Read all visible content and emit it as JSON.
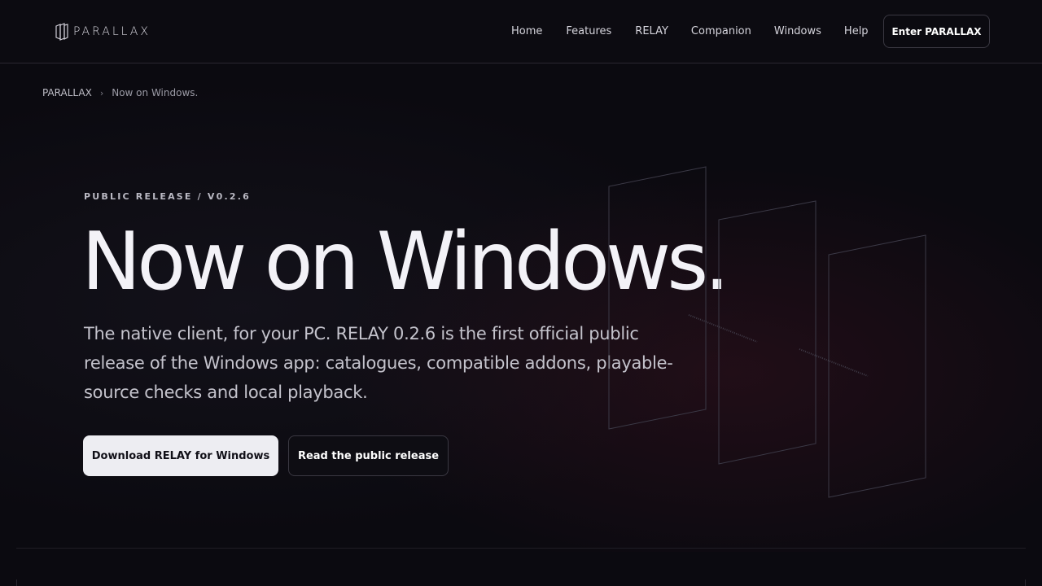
{
  "brand": {
    "name": "PARALLAX"
  },
  "nav": {
    "items": [
      "Home",
      "Features",
      "RELAY",
      "Companion",
      "Windows",
      "Help"
    ],
    "cta": "Enter PARALLAX"
  },
  "breadcrumb": {
    "root": "PARALLAX",
    "separator": "›",
    "current": "Now on Windows."
  },
  "hero": {
    "eyebrow": "PUBLIC RELEASE / V0.2.6",
    "title": "Now on Windows.",
    "description": "The native client, for your PC. RELAY 0.2.6 is the first official public release of the Windows app: catalogues, compatible addons, playable-source checks and local playback.",
    "primary_button": "Download RELAY for Windows",
    "secondary_button": "Read the public release"
  },
  "icons": {
    "logo": "parallax-logo-icon",
    "graphic": "window-panels-illustration"
  },
  "colors": {
    "background": "#0b0a10",
    "text": "#ecebf2",
    "primary_button_bg": "#ededf2",
    "border": "#2a2831"
  }
}
